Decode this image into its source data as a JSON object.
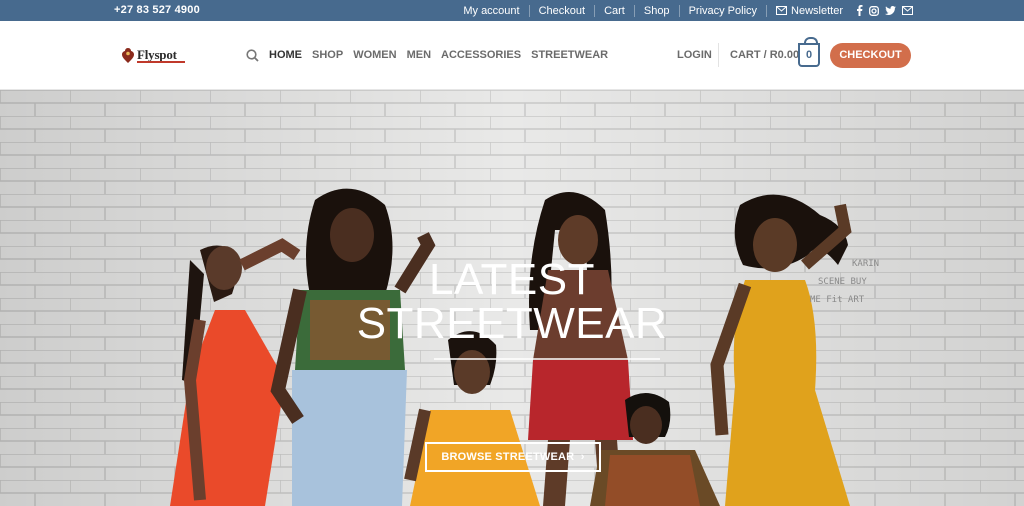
{
  "topbar": {
    "phone": "+27 83 527 4900",
    "links": [
      "My account",
      "Checkout",
      "Cart",
      "Shop",
      "Privacy Policy"
    ],
    "newsletter": "Newsletter",
    "social": [
      "facebook-icon",
      "instagram-icon",
      "twitter-icon",
      "email-icon"
    ]
  },
  "logo": {
    "text": "Flyspot"
  },
  "nav": {
    "items": [
      "HOME",
      "SHOP",
      "WOMEN",
      "MEN",
      "ACCESSORIES",
      "STREETWEAR"
    ]
  },
  "header": {
    "login": "LOGIN",
    "cart": "CART / R0.00",
    "cart_count": "0",
    "checkout": "CHECKOUT"
  },
  "hero": {
    "line1": "LATEST",
    "line2": "STREETWEAR",
    "button": "BROWSE STREETWEAR",
    "wall_text": "KARIN\nSCENE BUY\nME Fit ART"
  },
  "colors": {
    "topbar": "#476a8e",
    "accent": "#d26e4b"
  }
}
